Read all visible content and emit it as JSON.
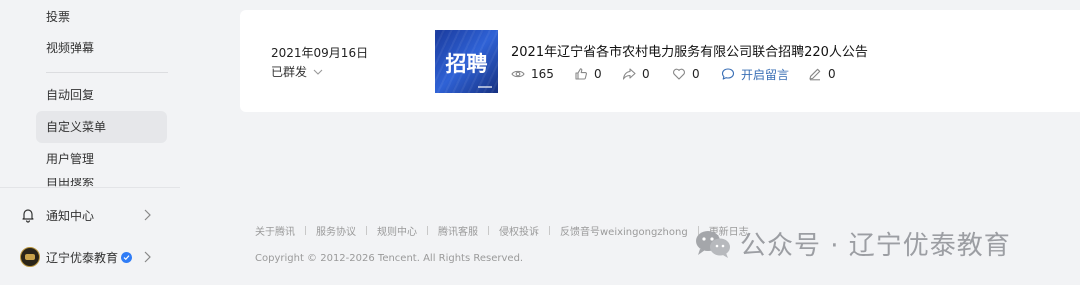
{
  "sidebar": {
    "items": [
      {
        "label": "投票"
      },
      {
        "label": "视频弹幕"
      },
      {
        "label": "自动回复"
      },
      {
        "label": "自定义菜单"
      },
      {
        "label": "用户管理"
      },
      {
        "label": "目由搜索"
      }
    ],
    "notifications_label": "通知中心",
    "account_name": "辽宁优泰教育"
  },
  "article": {
    "date": "2021年09月16日",
    "status": "已群发",
    "thumbnail_text": "招聘",
    "title": "2021年辽宁省各市农村电力服务有限公司联合招聘220人公告",
    "stats": {
      "reads": "165",
      "likes": "0",
      "shares": "0",
      "favorites": "0",
      "comments": "开启留言",
      "edits": "0"
    }
  },
  "footer": {
    "links": [
      "关于腾讯",
      "服务协议",
      "规则中心",
      "腾讯客服",
      "侵权投诉",
      "反馈音号weixingongzhong",
      "更新日志"
    ],
    "copyright": "Copyright © 2012-2026 Tencent. All Rights Reserved."
  },
  "watermark": {
    "text": "公众号 · 辽宁优泰教育"
  },
  "colors": {
    "background": "#f2f3f5",
    "card": "#ffffff",
    "link_blue": "#3a6fb5",
    "active_item": "#e6e7ea",
    "thumbnail_blue": "#2f62d6"
  }
}
